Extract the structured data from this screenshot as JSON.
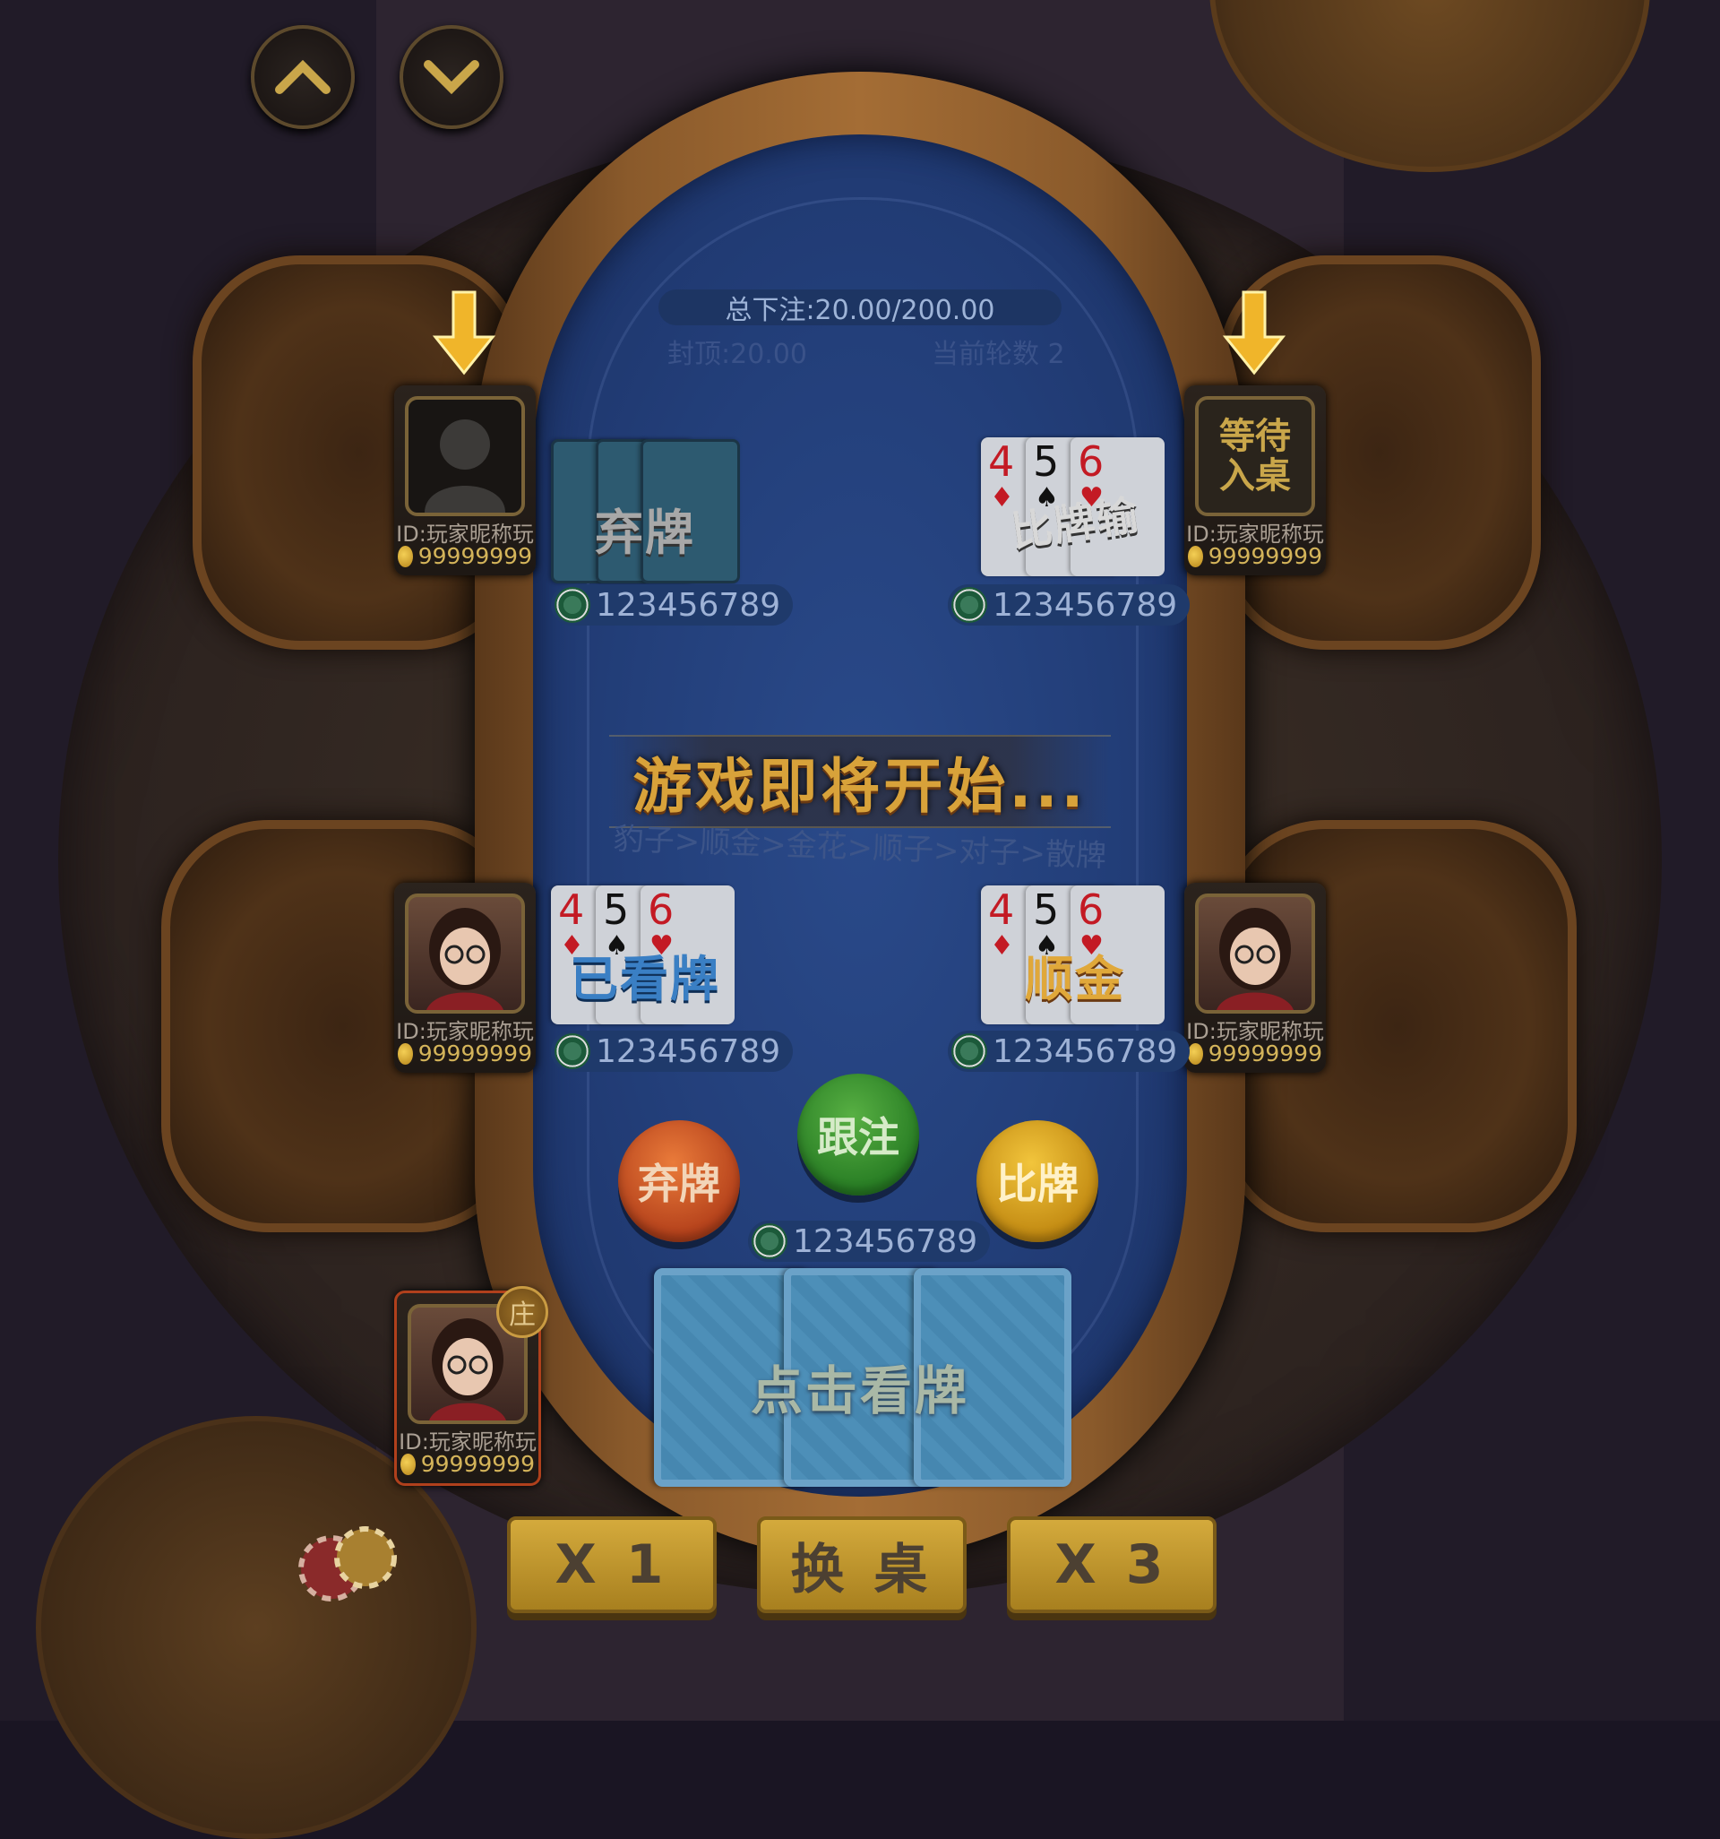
{
  "top_controls": {
    "up_icon": "chevron-up-icon",
    "down_icon": "chevron-down-icon"
  },
  "table_info": {
    "total_bet": "总下注:20.00/200.00",
    "cap": "封顶:20.00",
    "current_round": "当前轮数 2"
  },
  "banner": {
    "title": "游戏即将开始...",
    "rank_hint": "豹子>顺金>金花>顺子>对子>散牌"
  },
  "players": [
    {
      "id": "ID:玩家昵称玩",
      "coins": "99999999",
      "avatar": "silhouette",
      "cards_status": "弃牌",
      "bet": "123456789"
    },
    {
      "id": "ID:玩家昵称玩",
      "coins": "99999999",
      "avatar_label": "等待入桌",
      "cards": [
        "4",
        "5",
        "6"
      ],
      "cards_status": "比牌输",
      "bet": "123456789"
    },
    {
      "id": "ID:玩家昵称玩",
      "coins": "99999999",
      "avatar": "girl-avatar",
      "cards": [
        "4",
        "5",
        "6"
      ],
      "cards_status": "已看牌",
      "bet": "123456789"
    },
    {
      "id": "ID:玩家昵称玩",
      "coins": "99999999",
      "avatar": "girl-avatar",
      "cards": [
        "4",
        "5",
        "6"
      ],
      "cards_status": "顺金",
      "bet": "123456789"
    },
    {
      "id": "ID:玩家昵称玩",
      "coins": "99999999",
      "avatar": "girl-avatar",
      "banker": "庄"
    }
  ],
  "actions": {
    "fold": "弃牌",
    "call": "跟注",
    "compare": "比牌",
    "my_bet": "123456789",
    "look_cards": "点击看牌"
  },
  "bottom": {
    "x1": "X 1",
    "change_table": "换 桌",
    "x3": "X 3"
  },
  "colors": {
    "felt": "#233f7a",
    "gold": "#d4aa3c",
    "wood": "#8a5a2b"
  }
}
